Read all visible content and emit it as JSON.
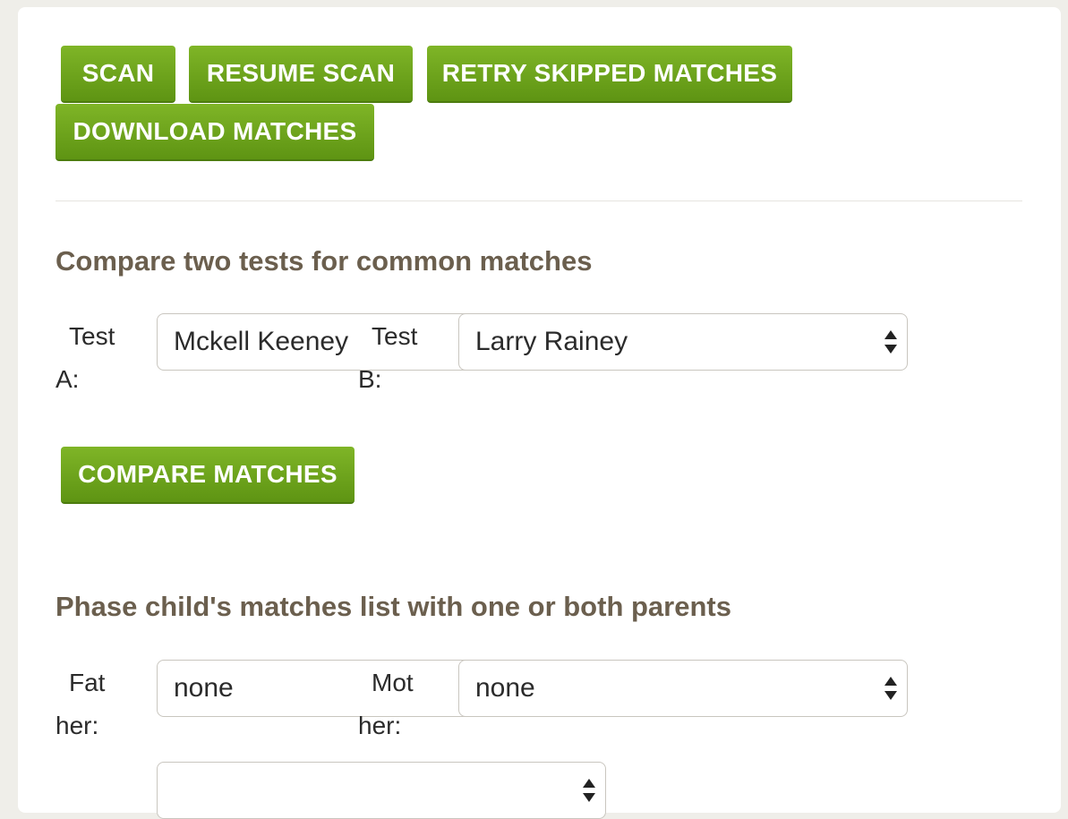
{
  "toolbar": {
    "scan_label": "SCAN",
    "resume_scan_label": "RESUME SCAN",
    "retry_skipped_label": "RETRY SKIPPED MATCHES",
    "download_matches_label": "DOWNLOAD MATCHES"
  },
  "compare": {
    "heading": "Compare two tests for common matches",
    "test_a_label": "Test A:",
    "test_a_value": "Mckell Keeney",
    "test_b_label": "Test B:",
    "test_b_value": "Larry Rainey",
    "compare_button_label": "COMPARE MATCHES"
  },
  "phase": {
    "heading": "Phase child's matches list with one or both parents",
    "father_label": "Father:",
    "father_value": "none",
    "mother_label": "Mother:",
    "mother_value": "none"
  },
  "icons": {
    "select_arrows": "up-down-arrows-icon"
  },
  "colors": {
    "button_green": "#6ea11d",
    "heading_brown": "#6b5f4e",
    "page_background": "#efeee9"
  }
}
